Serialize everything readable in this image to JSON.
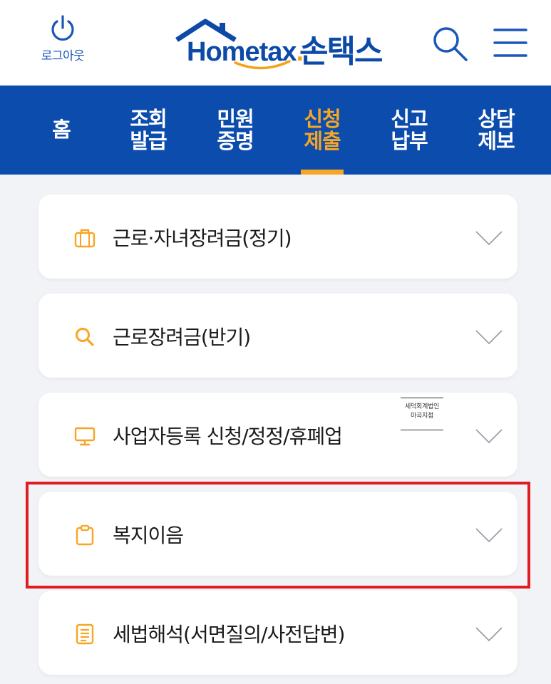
{
  "header": {
    "logout_label": "로그아웃",
    "brand_name": "Hometax",
    "brand_suffix": ".",
    "brand_korean": "손택스"
  },
  "nav": {
    "items": [
      {
        "label": "홈",
        "active": false
      },
      {
        "label": "조회\n발급",
        "active": false
      },
      {
        "label": "민원\n증명",
        "active": false
      },
      {
        "label": "신청\n제출",
        "active": true
      },
      {
        "label": "신고\n납부",
        "active": false
      },
      {
        "label": "상담\n제보",
        "active": false
      }
    ]
  },
  "menu": {
    "items": [
      {
        "icon": "briefcase-icon",
        "title": "근로·자녀장려금(정기)"
      },
      {
        "icon": "search-icon",
        "title": "근로장려금(반기)"
      },
      {
        "icon": "monitor-icon",
        "title": "사업자등록 신청/정정/휴폐업"
      },
      {
        "icon": "clipboard-icon",
        "title": "복지이음"
      },
      {
        "icon": "document-icon",
        "title": "세법해석(서면질의/사전답변)"
      }
    ]
  },
  "watermark": {
    "line1": "세덕회계법인",
    "line2": "마곡지점"
  },
  "colors": {
    "primary_blue": "#0c4cad",
    "accent_orange": "#f6a623",
    "highlight_red": "#e01d23",
    "background": "#f2f3f6"
  }
}
